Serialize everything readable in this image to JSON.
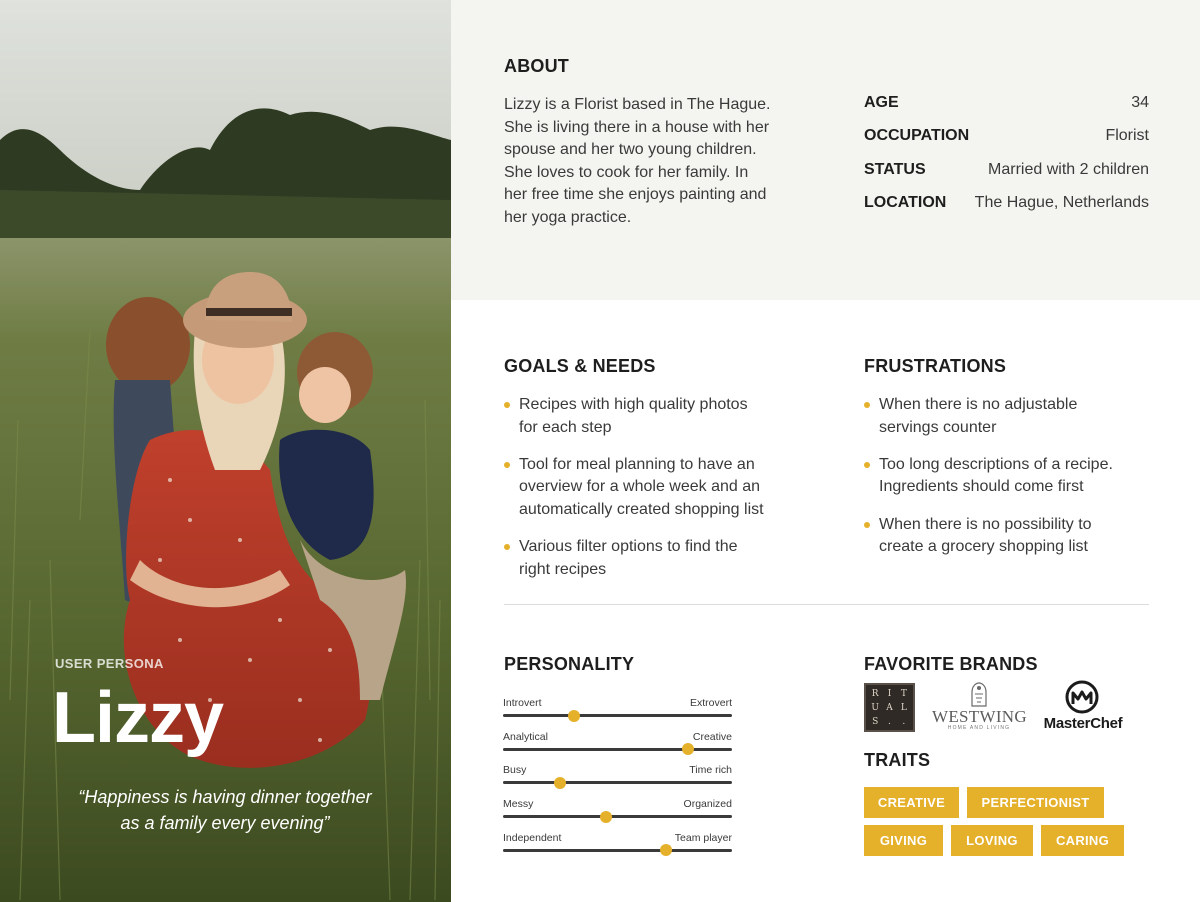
{
  "persona": {
    "label": "USER PERSONA",
    "name": "Lizzy",
    "quote_line1": "“Happiness is having dinner together",
    "quote_line2": "as a family every evening”"
  },
  "about": {
    "heading": "ABOUT",
    "lines": [
      "Lizzy is a Florist based in The Hague.",
      "She is living there in a house with her",
      "spouse and her two young children.",
      "She loves to cook for her family. In",
      "her free time she enjoys painting and",
      "her yoga practice."
    ]
  },
  "facts": [
    {
      "key": "AGE",
      "value": "34"
    },
    {
      "key": "OCCUPATION",
      "value": "Florist"
    },
    {
      "key": "STATUS",
      "value": "Married with 2 children"
    },
    {
      "key": "LOCATION",
      "value": "The Hague, Netherlands"
    }
  ],
  "goals": {
    "heading": "GOALS & NEEDS",
    "items": [
      [
        "Recipes with high quality photos",
        "for each step"
      ],
      [
        "Tool for meal planning to have an",
        "overview for a whole week and an",
        "automatically created shopping list"
      ],
      [
        "Various filter options to find the",
        "right recipes"
      ]
    ]
  },
  "frustrations": {
    "heading": "FRUSTRATIONS",
    "items": [
      [
        "When there is no adjustable",
        "servings counter"
      ],
      [
        "Too long descriptions of a recipe.",
        "Ingredients should come first"
      ],
      [
        "When there is no possibility to",
        "create a grocery shopping list"
      ]
    ]
  },
  "personality": {
    "heading": "PERSONALITY",
    "sliders": [
      {
        "left": "Introvert",
        "right": "Extrovert",
        "value": 0.31
      },
      {
        "left": "Analytical",
        "right": "Creative",
        "value": 0.81
      },
      {
        "left": "Busy",
        "right": "Time rich",
        "value": 0.25
      },
      {
        "left": "Messy",
        "right": "Organized",
        "value": 0.45
      },
      {
        "left": "Independent",
        "right": "Team player",
        "value": 0.71
      }
    ]
  },
  "brands": {
    "heading": "FAVORITE BRANDS",
    "rituals_letters": [
      "R",
      "I",
      "T",
      "U",
      "A",
      "L",
      "S",
      ".",
      "."
    ],
    "westwing": "WESTWING",
    "westwing_sub": "HOME AND LIVING",
    "masterchef": "MasterChef"
  },
  "traits": {
    "heading": "TRAITS",
    "items": [
      "CREATIVE",
      "PERFECTIONIST",
      "GIVING",
      "LOVING",
      "CARING"
    ]
  },
  "colors": {
    "accent": "#e5b02a",
    "about_bg": "#f4f4f0",
    "text_dark": "#1e1e1e"
  }
}
